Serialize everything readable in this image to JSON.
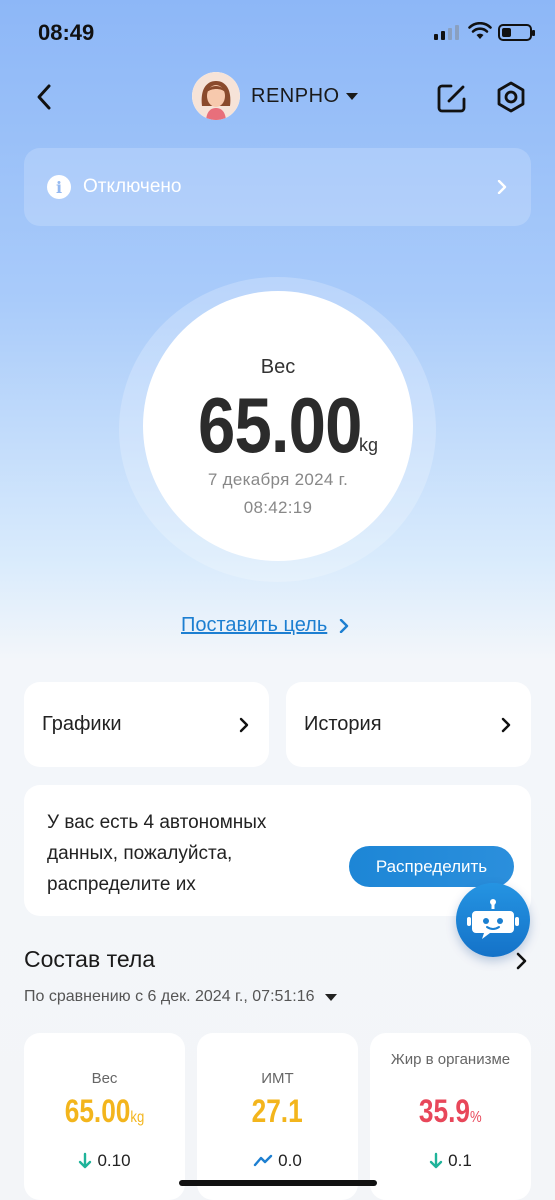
{
  "status_bar": {
    "time": "08:49"
  },
  "header": {
    "profile_name": "RENPHO"
  },
  "banner": {
    "text": "Отключено"
  },
  "weight": {
    "label": "Вес",
    "value": "65.00",
    "unit": "kg",
    "date": "7 декабря 2024 г.",
    "time": "08:42:19"
  },
  "goal_link": "Поставить цель",
  "nav_cards": {
    "charts": "Графики",
    "history": "История"
  },
  "offline": {
    "message": "У вас есть 4 автономных данных, пожалуйста, распределите их",
    "button": "Распределить"
  },
  "body_composition": {
    "title": "Состав тела",
    "compare": "По сравнению с 6 дек. 2024 г., 07:51:16",
    "metrics": [
      {
        "label": "Вес",
        "value": "65.00",
        "unit": "kg",
        "delta": "0.10",
        "color": "#f3b51c",
        "trend": "down"
      },
      {
        "label": "ИМТ",
        "value": "27.1",
        "unit": "",
        "delta": "0.0",
        "color": "#f3b51c",
        "trend": "flat"
      },
      {
        "label": "Жир в организме",
        "value": "35.9",
        "unit": "%",
        "delta": "0.1",
        "color": "#e8475a",
        "trend": "down"
      }
    ]
  },
  "colors": {
    "accent": "#1d86d6",
    "link": "#1d7fd1",
    "positive": "#1fb39a"
  }
}
